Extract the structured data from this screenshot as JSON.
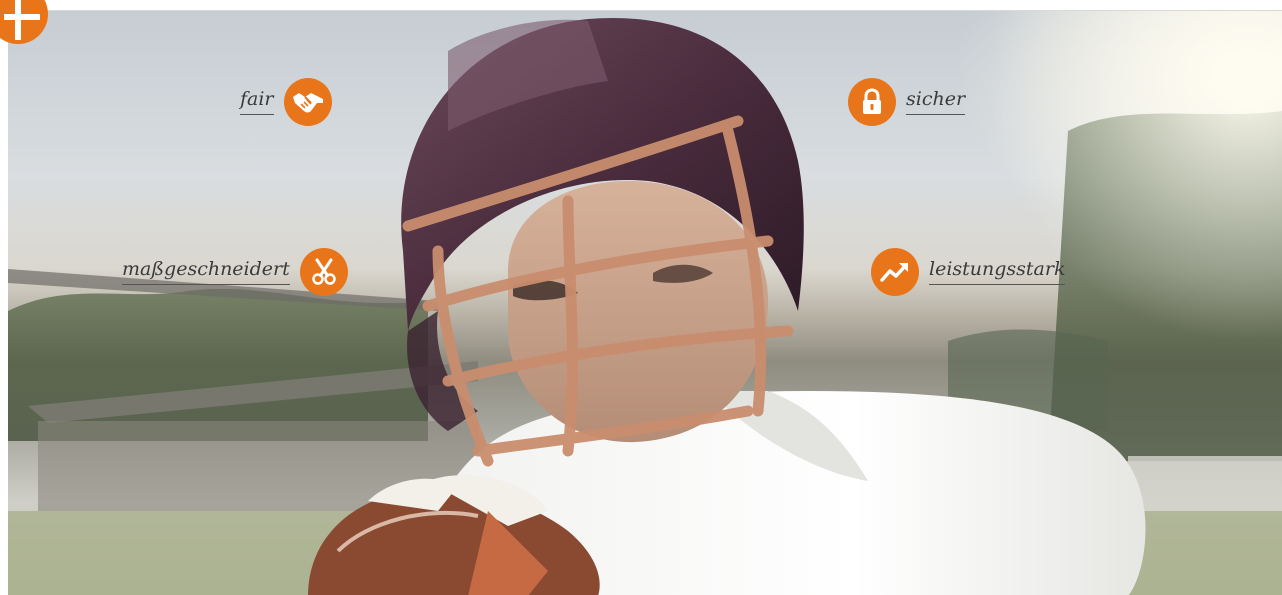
{
  "features": {
    "fair": {
      "label": "fair",
      "icon": "handshake-icon"
    },
    "sicher": {
      "label": "sicher",
      "icon": "padlock-icon"
    },
    "massgeschneidert": {
      "label": "maßgeschneidert",
      "icon": "scissors-icon"
    },
    "leistungsstark": {
      "label": "leistungsstark",
      "icon": "trending-up-icon"
    }
  },
  "colors": {
    "accent": "#e8751a",
    "label_text": "#3a3a3a",
    "underline": "#555555"
  },
  "image": {
    "subject": "american-football-player",
    "corner_badge_icon": "plus-cross-icon"
  }
}
